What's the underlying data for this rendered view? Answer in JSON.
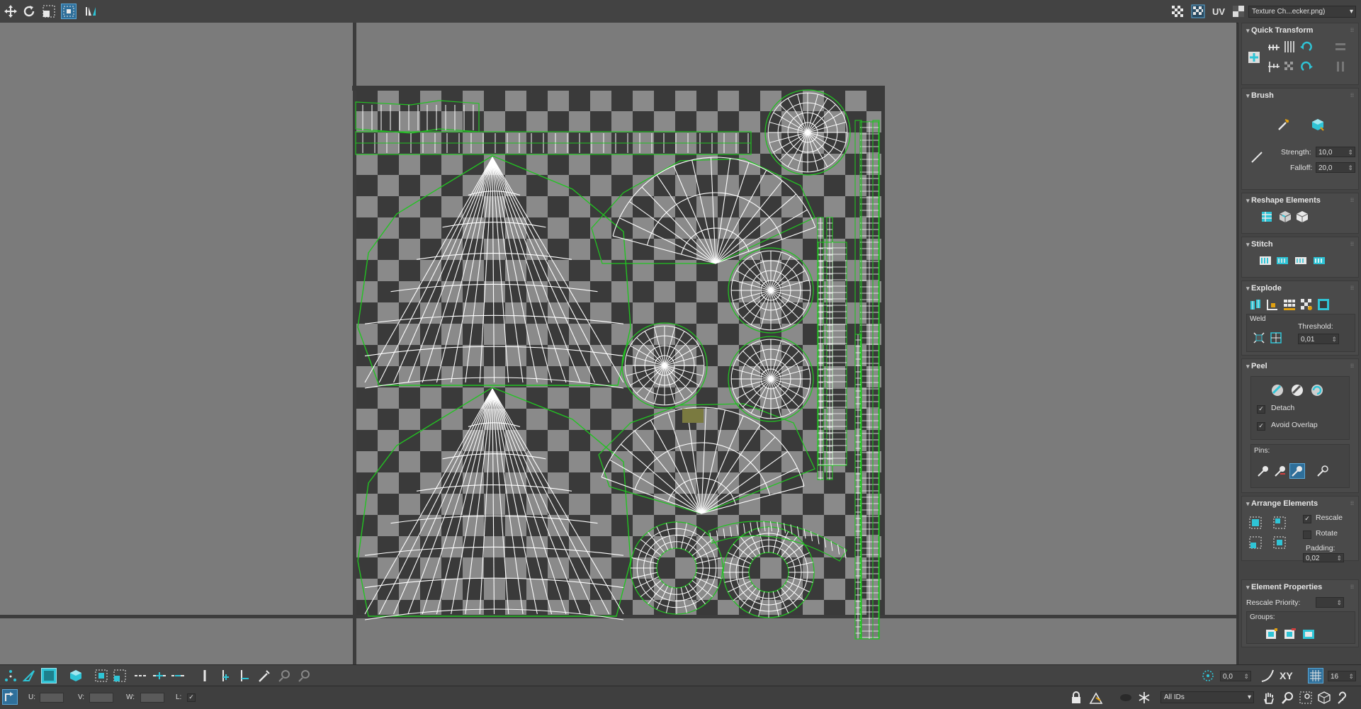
{
  "toolbar": {
    "uv_label": "UV",
    "texture_select": "Texture Ch...ecker.png)"
  },
  "panel": {
    "quick_transform": {
      "title": "Quick Transform"
    },
    "brush": {
      "title": "Brush",
      "strength_label": "Strength:",
      "strength_value": "10,0",
      "falloff_label": "Falloff:",
      "falloff_value": "20,0"
    },
    "reshape": {
      "title": "Reshape Elements"
    },
    "stitch": {
      "title": "Stitch"
    },
    "explode": {
      "title": "Explode",
      "weld_label": "Weld",
      "threshold_label": "Threshold:",
      "threshold_value": "0,01"
    },
    "peel": {
      "title": "Peel",
      "detach_label": "Detach",
      "avoid_overlap_label": "Avoid Overlap",
      "pins_label": "Pins:"
    },
    "arrange": {
      "title": "Arrange Elements",
      "rescale_label": "Rescale",
      "rotate_label": "Rotate",
      "padding_label": "Padding:",
      "padding_value": "0,02"
    },
    "element_props": {
      "title": "Element Properties",
      "rescale_priority_label": "Rescale Priority:",
      "groups_label": "Groups:"
    }
  },
  "bottombar": {
    "angle_value": "0,0",
    "xy_label": "XY",
    "grid_value": "16"
  },
  "statusbar": {
    "u_label": "U:",
    "v_label": "V:",
    "w_label": "W:",
    "l_label": "L:",
    "ids_select": "All IDs"
  },
  "colors": {
    "viewport_bg": "#7b7b7b",
    "checker_dark": "#3a3a3a",
    "checker_light": "#8a8a8a",
    "uv_edge": "#ffffff",
    "uv_border": "#22c322",
    "accent": "#2fc4d6"
  }
}
